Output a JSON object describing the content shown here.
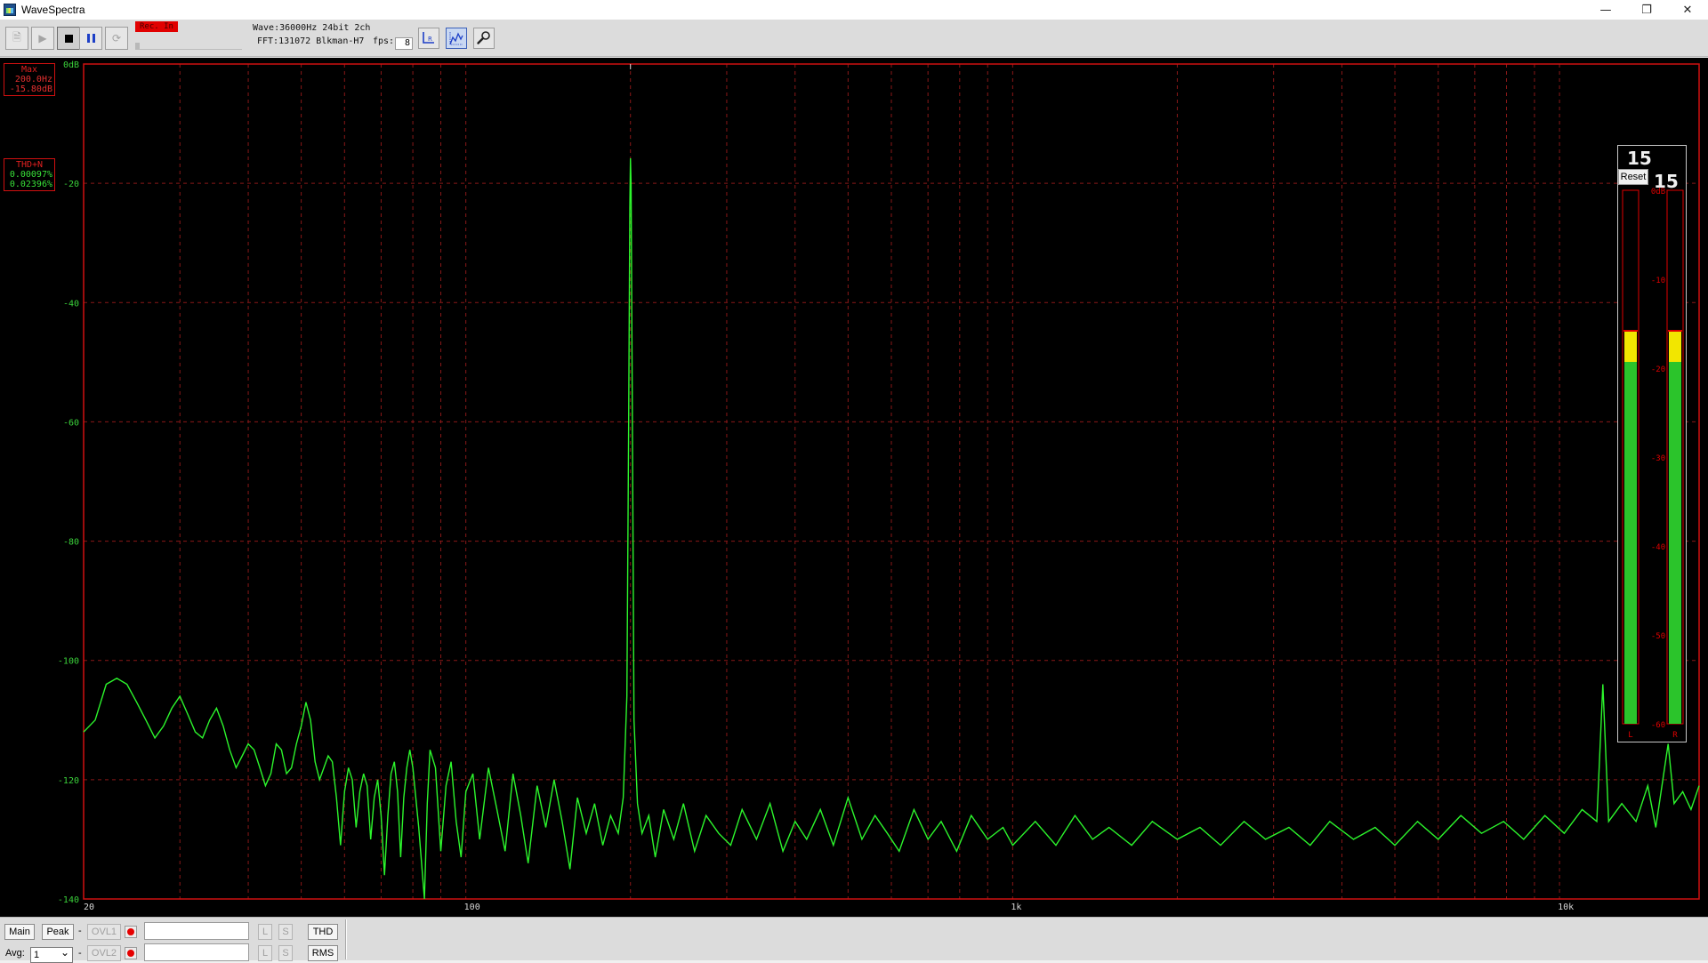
{
  "window": {
    "title": "WaveSpectra",
    "minimize_glyph": "—",
    "restore_glyph": "❐",
    "close_glyph": "✕"
  },
  "toolbar": {
    "rec_in_label": "Rec. In",
    "wave_info": "Wave:36000Hz 24bit 2ch",
    "fft_info": "FFT:131072 Blkman-H7",
    "fps_label": "fps:",
    "fps_value": "8",
    "icons": [
      "open-file-icon",
      "play-icon",
      "stop-icon",
      "pause-icon",
      "loop-icon",
      "lr-channel-icon",
      "spectrum-scale-icon",
      "settings-wrench-icon"
    ]
  },
  "readouts": {
    "peak_label": "Max",
    "peak_freq": "200.0Hz",
    "peak_level": "-15.80dB",
    "thd_label": "THD+N",
    "thd_value": "0.00097%",
    "thdn_value": "0.02396%"
  },
  "meter": {
    "peak_left": "15",
    "peak_right": "15",
    "reset_label": "Reset",
    "scale_labels": [
      "0dB",
      "-10",
      "-20",
      "-30",
      "-40",
      "-50",
      "-60"
    ],
    "channel_left": "L",
    "channel_right": "R",
    "level_left_db": -19.3,
    "level_right_db": -19.3,
    "hold_left_db": -15.8,
    "hold_right_db": -15.8,
    "colors": {
      "green": "#2bc42b",
      "yellow": "#f2e600",
      "red": "#e00000"
    }
  },
  "bottombar": {
    "main_label": "Main",
    "peak_label": "Peak",
    "ovl1_label": "OVL1",
    "ovl2_label": "OVL2",
    "dash": "-",
    "avg_label": "Avg:",
    "avg_value": "1",
    "l_label": "L",
    "s_label": "S",
    "thd_button": "THD",
    "rms_button": "RMS"
  },
  "colors": {
    "trace": "#2cf52c",
    "grid": "#8a1818",
    "axis_text_y": "#3ad03a",
    "axis_text_x": "#d8d8d8",
    "frame": "#d01010"
  },
  "chart_data": {
    "type": "line",
    "xscale": "log",
    "xlim": [
      20,
      18000
    ],
    "ylim": [
      -140,
      0
    ],
    "x_tick_labels": [
      "20",
      "100",
      "1k",
      "10k"
    ],
    "y_tick_labels": [
      "0dB",
      "-20",
      "-40",
      "-60",
      "-80",
      "-100",
      "-120",
      "-140"
    ],
    "grid": true,
    "series": [
      {
        "points": [
          [
            20,
            -112
          ],
          [
            21,
            -110
          ],
          [
            22,
            -104
          ],
          [
            23,
            -103
          ],
          [
            24,
            -104
          ],
          [
            25,
            -107
          ],
          [
            26,
            -110
          ],
          [
            27,
            -113
          ],
          [
            28,
            -111
          ],
          [
            29,
            -108
          ],
          [
            30,
            -106
          ],
          [
            31,
            -109
          ],
          [
            32,
            -112
          ],
          [
            33,
            -113
          ],
          [
            34,
            -110
          ],
          [
            35,
            -108
          ],
          [
            36,
            -111
          ],
          [
            37,
            -115
          ],
          [
            38,
            -118
          ],
          [
            39,
            -116
          ],
          [
            40,
            -114
          ],
          [
            41,
            -115
          ],
          [
            42,
            -118
          ],
          [
            43,
            -121
          ],
          [
            44,
            -119
          ],
          [
            45,
            -114
          ],
          [
            46,
            -115
          ],
          [
            47,
            -119
          ],
          [
            48,
            -118
          ],
          [
            49,
            -114
          ],
          [
            50,
            -111
          ],
          [
            51,
            -107
          ],
          [
            52,
            -110
          ],
          [
            53,
            -117
          ],
          [
            54,
            -120
          ],
          [
            55,
            -118
          ],
          [
            56,
            -116
          ],
          [
            57,
            -117
          ],
          [
            58,
            -123
          ],
          [
            59,
            -131
          ],
          [
            60,
            -122
          ],
          [
            61,
            -118
          ],
          [
            62,
            -120
          ],
          [
            63,
            -128
          ],
          [
            64,
            -122
          ],
          [
            65,
            -119
          ],
          [
            66,
            -121
          ],
          [
            67,
            -130
          ],
          [
            68,
            -123
          ],
          [
            69,
            -120
          ],
          [
            70,
            -126
          ],
          [
            71,
            -136
          ],
          [
            72,
            -126
          ],
          [
            73,
            -119
          ],
          [
            74,
            -117
          ],
          [
            75,
            -122
          ],
          [
            76,
            -133
          ],
          [
            77,
            -123
          ],
          [
            78,
            -118
          ],
          [
            79,
            -115
          ],
          [
            80,
            -118
          ],
          [
            82,
            -128
          ],
          [
            84,
            -140
          ],
          [
            85,
            -124
          ],
          [
            86,
            -115
          ],
          [
            88,
            -118
          ],
          [
            90,
            -132
          ],
          [
            92,
            -121
          ],
          [
            94,
            -117
          ],
          [
            96,
            -127
          ],
          [
            98,
            -133
          ],
          [
            100,
            -122
          ],
          [
            103,
            -119
          ],
          [
            106,
            -130
          ],
          [
            110,
            -118
          ],
          [
            114,
            -125
          ],
          [
            118,
            -132
          ],
          [
            122,
            -119
          ],
          [
            126,
            -126
          ],
          [
            130,
            -134
          ],
          [
            135,
            -121
          ],
          [
            140,
            -128
          ],
          [
            145,
            -120
          ],
          [
            150,
            -127
          ],
          [
            155,
            -135
          ],
          [
            160,
            -123
          ],
          [
            166,
            -129
          ],
          [
            172,
            -124
          ],
          [
            178,
            -131
          ],
          [
            184,
            -126
          ],
          [
            190,
            -129
          ],
          [
            194,
            -123
          ],
          [
            197,
            -106
          ],
          [
            198.5,
            -60
          ],
          [
            199.5,
            -24
          ],
          [
            200,
            -15.8
          ],
          [
            200.5,
            -20
          ],
          [
            201.5,
            -55
          ],
          [
            203,
            -110
          ],
          [
            206,
            -124
          ],
          [
            210,
            -129
          ],
          [
            216,
            -126
          ],
          [
            222,
            -133
          ],
          [
            230,
            -125
          ],
          [
            240,
            -130
          ],
          [
            250,
            -124
          ],
          [
            262,
            -132
          ],
          [
            275,
            -126
          ],
          [
            290,
            -129
          ],
          [
            305,
            -131
          ],
          [
            320,
            -125
          ],
          [
            340,
            -130
          ],
          [
            360,
            -124
          ],
          [
            380,
            -132
          ],
          [
            400,
            -127
          ],
          [
            420,
            -130
          ],
          [
            445,
            -125
          ],
          [
            470,
            -131
          ],
          [
            500,
            -123
          ],
          [
            530,
            -130
          ],
          [
            560,
            -126
          ],
          [
            590,
            -129
          ],
          [
            620,
            -132
          ],
          [
            660,
            -125
          ],
          [
            700,
            -130
          ],
          [
            740,
            -127
          ],
          [
            790,
            -132
          ],
          [
            840,
            -126
          ],
          [
            900,
            -130
          ],
          [
            960,
            -128
          ],
          [
            1000,
            -131
          ],
          [
            1100,
            -127
          ],
          [
            1200,
            -131
          ],
          [
            1300,
            -126
          ],
          [
            1400,
            -130
          ],
          [
            1500,
            -128
          ],
          [
            1650,
            -131
          ],
          [
            1800,
            -127
          ],
          [
            2000,
            -130
          ],
          [
            2200,
            -128
          ],
          [
            2400,
            -131
          ],
          [
            2650,
            -127
          ],
          [
            2900,
            -130
          ],
          [
            3200,
            -128
          ],
          [
            3500,
            -131
          ],
          [
            3800,
            -127
          ],
          [
            4200,
            -130
          ],
          [
            4600,
            -128
          ],
          [
            5000,
            -131
          ],
          [
            5500,
            -127
          ],
          [
            6000,
            -130
          ],
          [
            6600,
            -126
          ],
          [
            7200,
            -129
          ],
          [
            7900,
            -127
          ],
          [
            8600,
            -130
          ],
          [
            9400,
            -126
          ],
          [
            10200,
            -129
          ],
          [
            11000,
            -125
          ],
          [
            11700,
            -127
          ],
          [
            12000,
            -104
          ],
          [
            12300,
            -127
          ],
          [
            13000,
            -124
          ],
          [
            13800,
            -127
          ],
          [
            14500,
            -121
          ],
          [
            15000,
            -128
          ],
          [
            15800,
            -114
          ],
          [
            16200,
            -124
          ],
          [
            16800,
            -122
          ],
          [
            17400,
            -125
          ],
          [
            18000,
            -121
          ]
        ]
      }
    ],
    "noise_floor_db": -140
  }
}
